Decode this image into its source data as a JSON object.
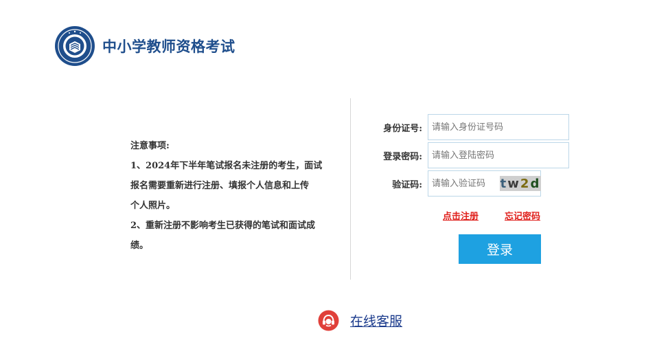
{
  "header": {
    "logo_icon": "exam-emblem-icon",
    "title": "中小学教师资格考试"
  },
  "notice": {
    "heading": "注意事项:",
    "line1": "1、2024年下半年笔试报名未注册的考生，面试",
    "line2": "报名需要重新进行注册、填报个人信息和上传",
    "line3": "个人照片。",
    "line4": "2、重新注册不影响考生已获得的笔试和面试成",
    "line5": "绩。"
  },
  "form": {
    "id_label": "身份证号:",
    "id_placeholder": "请输入身份证号码",
    "password_label": "登录密码:",
    "password_placeholder": "请输入登陆密码",
    "captcha_label": "验证码:",
    "captcha_placeholder": "请输入验证码",
    "captcha_text": [
      "t",
      "w",
      "2",
      "d"
    ]
  },
  "links": {
    "register": "点击注册",
    "forgot": "忘记密码"
  },
  "login_button": "登录",
  "service": {
    "icon": "headset-icon",
    "label": "在线客服"
  },
  "colors": {
    "brand": "#1f4e8c",
    "button": "#1ea1e1",
    "link_red": "#e0201c",
    "service_icon": "#e0403a"
  }
}
